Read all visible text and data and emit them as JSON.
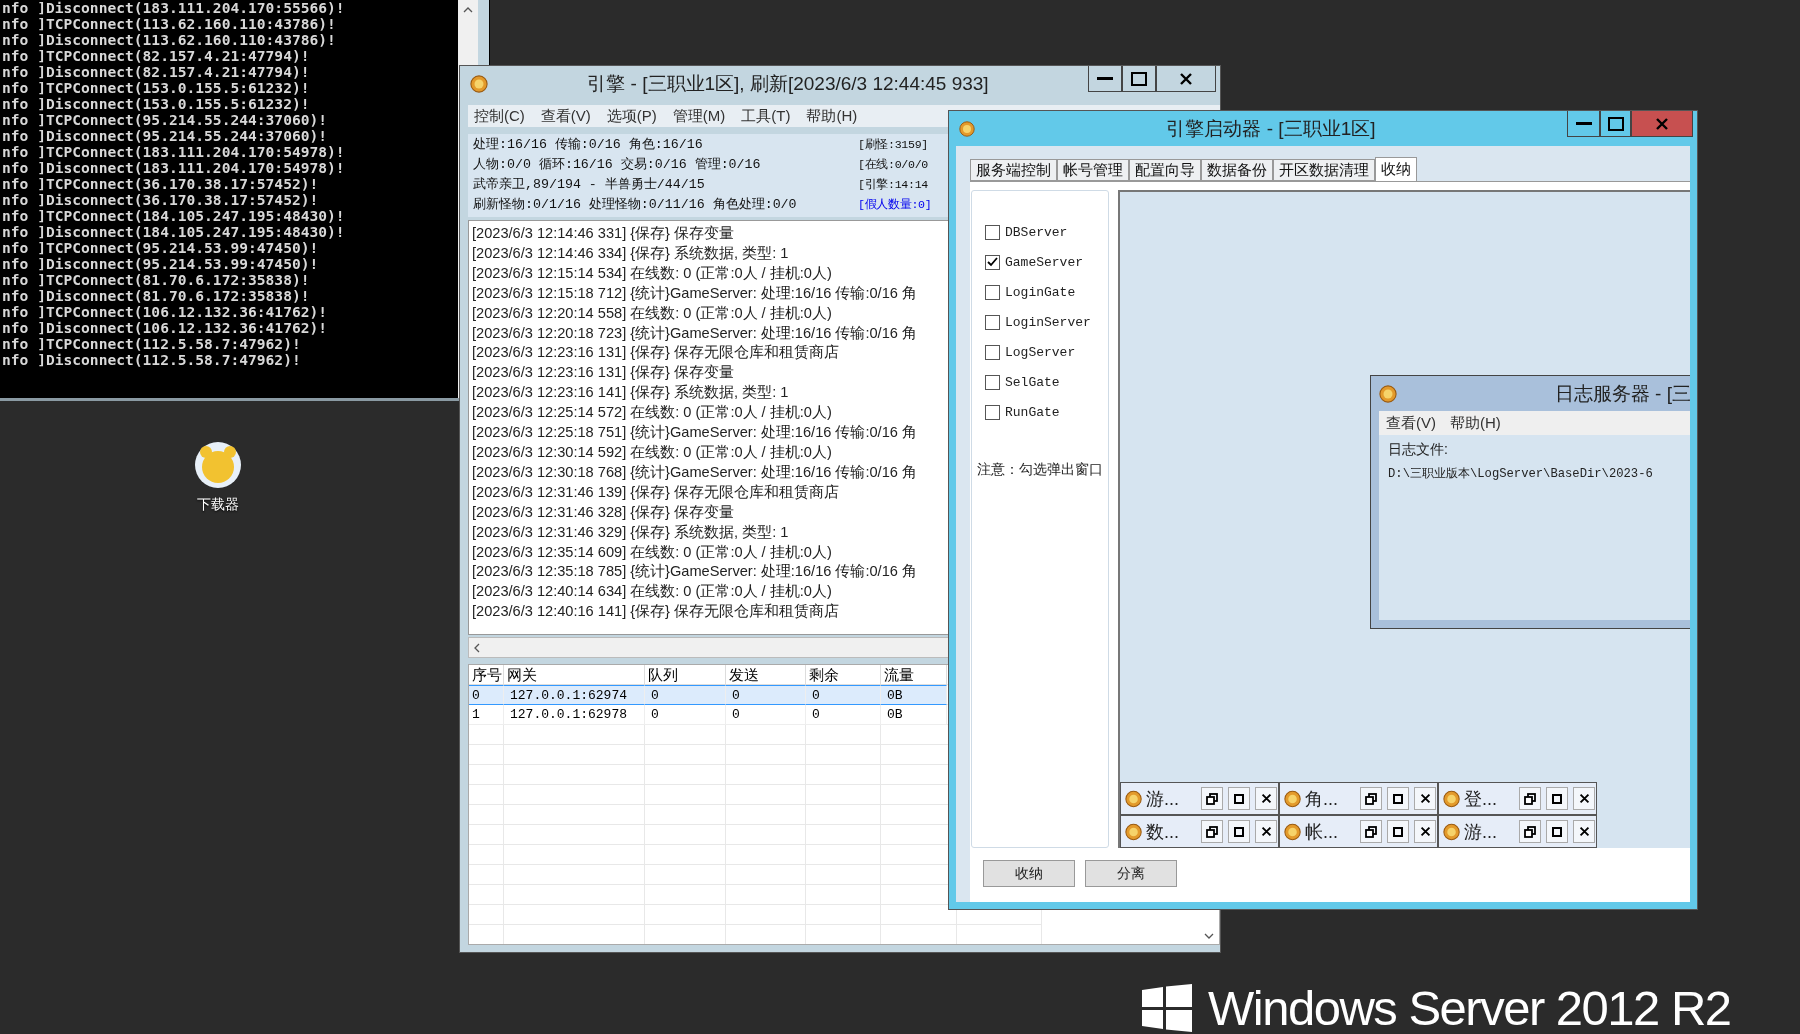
{
  "console": {
    "lines": [
      "nfo ]Disconnect(183.111.204.170:55566)!",
      "nfo ]TCPConnect(113.62.160.110:43786)!",
      "nfo ]Disconnect(113.62.160.110:43786)!",
      "nfo ]TCPConnect(82.157.4.21:47794)!",
      "nfo ]Disconnect(82.157.4.21:47794)!",
      "nfo ]TCPConnect(153.0.155.5:61232)!",
      "nfo ]Disconnect(153.0.155.5:61232)!",
      "nfo ]TCPConnect(95.214.55.244:37060)!",
      "nfo ]Disconnect(95.214.55.244:37060)!",
      "nfo ]TCPConnect(183.111.204.170:54978)!",
      "nfo ]Disconnect(183.111.204.170:54978)!",
      "nfo ]TCPConnect(36.170.38.17:57452)!",
      "nfo ]Disconnect(36.170.38.17:57452)!",
      "nfo ]TCPConnect(184.105.247.195:48430)!",
      "nfo ]Disconnect(184.105.247.195:48430)!",
      "nfo ]TCPConnect(95.214.53.99:47450)!",
      "nfo ]Disconnect(95.214.53.99:47450)!",
      "nfo ]TCPConnect(81.70.6.172:35838)!",
      "nfo ]Disconnect(81.70.6.172:35838)!",
      "nfo ]TCPConnect(106.12.132.36:41762)!",
      "nfo ]Disconnect(106.12.132.36:41762)!",
      "nfo ]TCPConnect(112.5.58.7:47962)!",
      "nfo ]Disconnect(112.5.58.7:47962)!"
    ]
  },
  "desktop_icons": [
    {
      "label": "下载器"
    }
  ],
  "engine_window": {
    "title": "引擎 - [三职业1区], 刷新[2023/6/3 12:44:45 933]",
    "menu": [
      "控制(C)",
      "查看(V)",
      "选项(P)",
      "管理(M)",
      "工具(T)",
      "帮助(H)"
    ],
    "stats": [
      "处理:16/16 传输:0/16 角色:16/16",
      "人物:0/0 循环:16/16 交易:0/16 管理:0/16",
      "武帝亲卫,89/194 - 半兽勇士/44/15",
      "刷新怪物:0/1/16 处理怪物:0/11/16 角色处理:0/0"
    ],
    "stats_right": [
      {
        "text": "[刷怪:3159]",
        "kind": "plain"
      },
      {
        "text": "[在线:0/0/0",
        "kind": "plain"
      },
      {
        "text": "[引擎:14:14",
        "kind": "plain"
      },
      {
        "text": "[假人数量:0]",
        "kind": "link"
      }
    ],
    "log": [
      "[2023/6/3 12:14:46 331] {保存} 保存变量",
      "[2023/6/3 12:14:46 334] {保存} 系统数据, 类型: 1",
      "[2023/6/3 12:15:14 534] 在线数: 0 (正常:0人 / 挂机:0人)",
      "[2023/6/3 12:15:18 712] {统计}GameServer: 处理:16/16 传输:0/16 角",
      "[2023/6/3 12:20:14 558] 在线数: 0 (正常:0人 / 挂机:0人)",
      "[2023/6/3 12:20:18 723] {统计}GameServer: 处理:16/16 传输:0/16 角",
      "[2023/6/3 12:23:16 131] {保存} 保存无限仓库和租赁商店",
      "[2023/6/3 12:23:16 131] {保存} 保存变量",
      "[2023/6/3 12:23:16 141] {保存} 系统数据, 类型: 1",
      "[2023/6/3 12:25:14 572] 在线数: 0 (正常:0人 / 挂机:0人)",
      "[2023/6/3 12:25:18 751] {统计}GameServer: 处理:16/16 传输:0/16 角",
      "[2023/6/3 12:30:14 592] 在线数: 0 (正常:0人 / 挂机:0人)",
      "[2023/6/3 12:30:18 768] {统计}GameServer: 处理:16/16 传输:0/16 角",
      "[2023/6/3 12:31:46 139] {保存} 保存无限仓库和租赁商店",
      "[2023/6/3 12:31:46 328] {保存} 保存变量",
      "[2023/6/3 12:31:46 329] {保存} 系统数据, 类型: 1",
      "[2023/6/3 12:35:14 609] 在线数: 0 (正常:0人 / 挂机:0人)",
      "[2023/6/3 12:35:18 785] {统计}GameServer: 处理:16/16 传输:0/16 角",
      "[2023/6/3 12:40:14 634] 在线数: 0 (正常:0人 / 挂机:0人)",
      "[2023/6/3 12:40:16 141] {保存} 保存无限仓库和租赁商店"
    ],
    "table": {
      "columns": [
        "序号",
        "网关",
        "队列",
        "发送",
        "剩余",
        "流量"
      ],
      "rows": [
        {
          "cells": [
            "0",
            "127.0.0.1:62974",
            "0",
            "0",
            "0",
            "0B"
          ],
          "selected": true
        },
        {
          "cells": [
            "1",
            "127.0.0.1:62978",
            "0",
            "0",
            "0",
            "0B"
          ],
          "selected": false
        }
      ]
    }
  },
  "launcher_window": {
    "title": "引擎启动器 - [三职业1区]",
    "tabs": [
      {
        "label": "服务端控制",
        "selected": false
      },
      {
        "label": "帐号管理",
        "selected": false
      },
      {
        "label": "配置向导",
        "selected": false
      },
      {
        "label": "数据备份",
        "selected": false
      },
      {
        "label": "开区数据清理",
        "selected": false
      },
      {
        "label": "收纳",
        "selected": true
      }
    ],
    "servers": [
      {
        "name": "DBServer",
        "checked": false
      },
      {
        "name": "GameServer",
        "checked": true
      },
      {
        "name": "LoginGate",
        "checked": false
      },
      {
        "name": "LoginServer",
        "checked": false
      },
      {
        "name": "LogServer",
        "checked": false
      },
      {
        "name": "SelGate",
        "checked": false
      },
      {
        "name": "RunGate",
        "checked": false
      }
    ],
    "note": "注意：勾选弹出窗口",
    "log_server": {
      "title": "日志服务器 - [三",
      "menu": [
        "查看(V)",
        "帮助(H)"
      ],
      "label": "日志文件:",
      "path": "D:\\三职业版本\\LogServer\\BaseDir\\2023-6"
    },
    "minimized": [
      {
        "label": "游..."
      },
      {
        "label": "角..."
      },
      {
        "label": "登..."
      },
      {
        "label": "数..."
      },
      {
        "label": "帐..."
      },
      {
        "label": "游..."
      }
    ],
    "buttons": [
      "收纳",
      "分离"
    ]
  },
  "brand": "Windows Server 2012 R2"
}
